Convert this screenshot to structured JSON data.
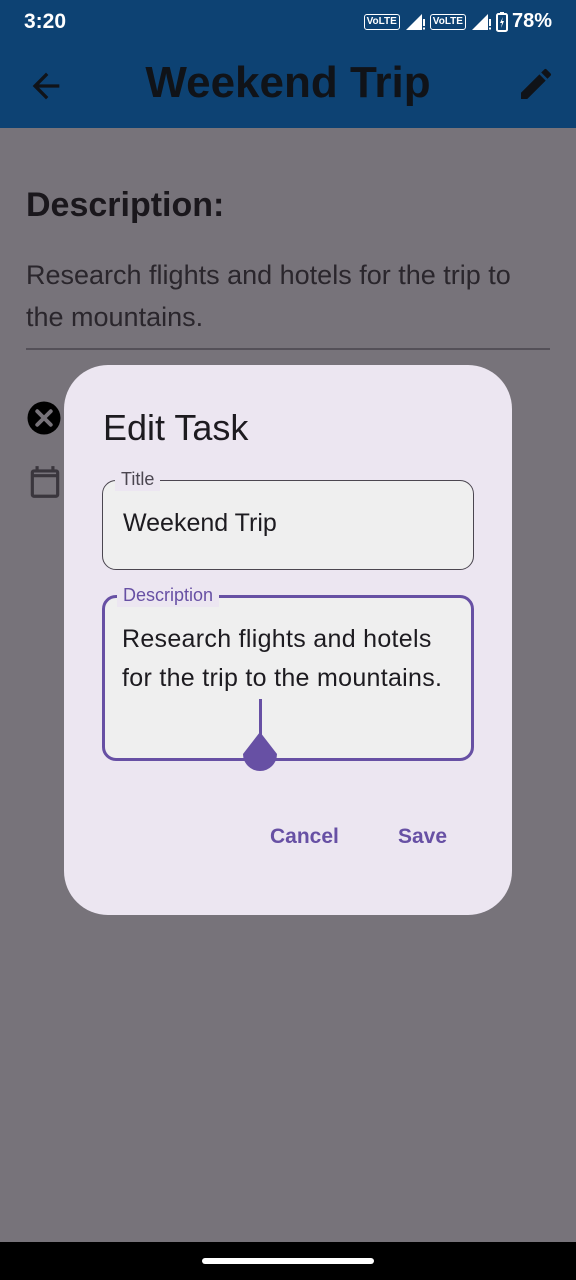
{
  "status_bar": {
    "time": "3:20",
    "volte_1": "VoLTE",
    "volte_2": "VoLTE",
    "battery": "78%"
  },
  "app_bar": {
    "title": "Weekend Trip",
    "back_icon": "arrow-back-icon",
    "edit_icon": "pencil-icon",
    "bg_color": "#0d4273"
  },
  "detail": {
    "heading": "Description:",
    "text": "Research flights and hotels for the trip to the mountains.",
    "status_icon": "cancel-circle-icon",
    "date_icon": "calendar-icon"
  },
  "dialog": {
    "title": "Edit Task",
    "title_field": {
      "label": "Title",
      "value": "Weekend Trip"
    },
    "description_field": {
      "label": "Description",
      "value": "Research flights and hotels for the trip to the mountains."
    },
    "cancel_label": "Cancel",
    "save_label": "Save",
    "accent_color": "#6750a4",
    "bg_color": "#ece6f1"
  }
}
